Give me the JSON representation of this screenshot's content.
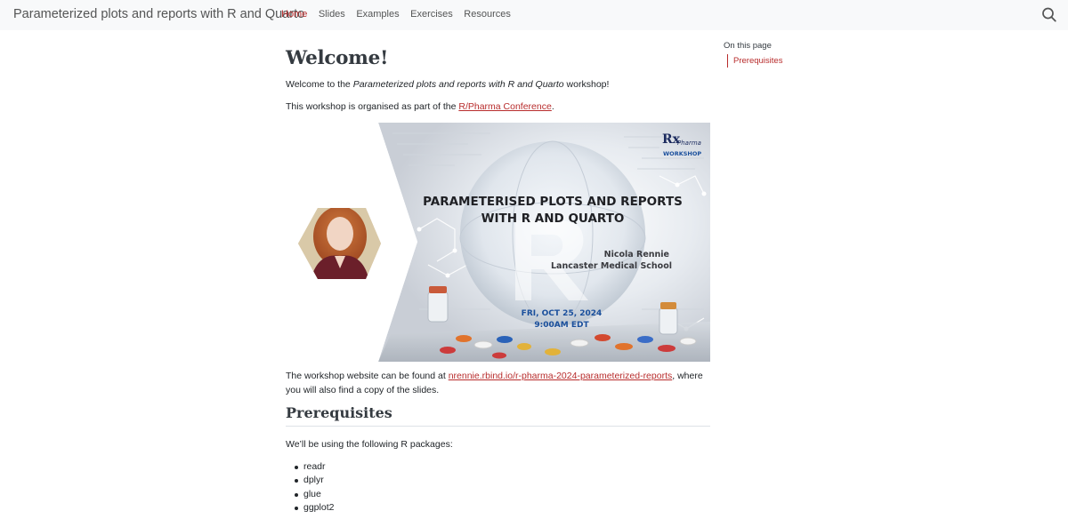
{
  "navbar": {
    "brand": "Parameterized plots and reports with R and Quarto",
    "links": [
      {
        "label": "Home",
        "active": true
      },
      {
        "label": "Slides"
      },
      {
        "label": "Examples"
      },
      {
        "label": "Exercises"
      },
      {
        "label": "Resources"
      }
    ],
    "search_icon": "search-icon"
  },
  "main": {
    "title": "Welcome!",
    "intro": {
      "prefix": "Welcome to the ",
      "emphasis": "Parameterized plots and reports with R and Quarto",
      "suffix": " workshop!"
    },
    "organised": {
      "prefix": "This workshop is organised as part of the ",
      "link": "R/Pharma Conference",
      "suffix": "."
    },
    "banner": {
      "logo_rx": "Rx",
      "logo_pharma": "Pharma",
      "logo_workshop": "WORKSHOP",
      "headline_line1": "PARAMETERISED PLOTS AND REPORTS",
      "headline_line2": "WITH R AND QUARTO",
      "speaker_name": "Nicola Rennie",
      "speaker_org": "Lancaster Medical School",
      "date": "FRI, OCT 25, 2024",
      "time": "9:00AM EDT",
      "colors": {
        "navy": "#1b2a5e",
        "blue": "#1a4f9c",
        "bg": "#e8ebef",
        "hex": "#d9c9a8",
        "hair": "#b45a2c",
        "shirt": "#6b1f2a"
      }
    },
    "website": {
      "prefix": "The workshop website can be found at ",
      "link": "nrennie.rbind.io/r-pharma-2024-parameterized-reports",
      "suffix": ", where you will also find a copy of the slides."
    },
    "prerequisites": {
      "heading": "Prerequisites",
      "intro": "We’ll be using the following R packages:",
      "packages": [
        "readr",
        "dplyr",
        "glue",
        "ggplot2"
      ]
    }
  },
  "toc": {
    "title": "On this page",
    "items": [
      "Prerequisites"
    ]
  },
  "theme": {
    "accent": "#b82c2c",
    "navbar_bg": "#f8f9fa",
    "text": "#212529"
  }
}
